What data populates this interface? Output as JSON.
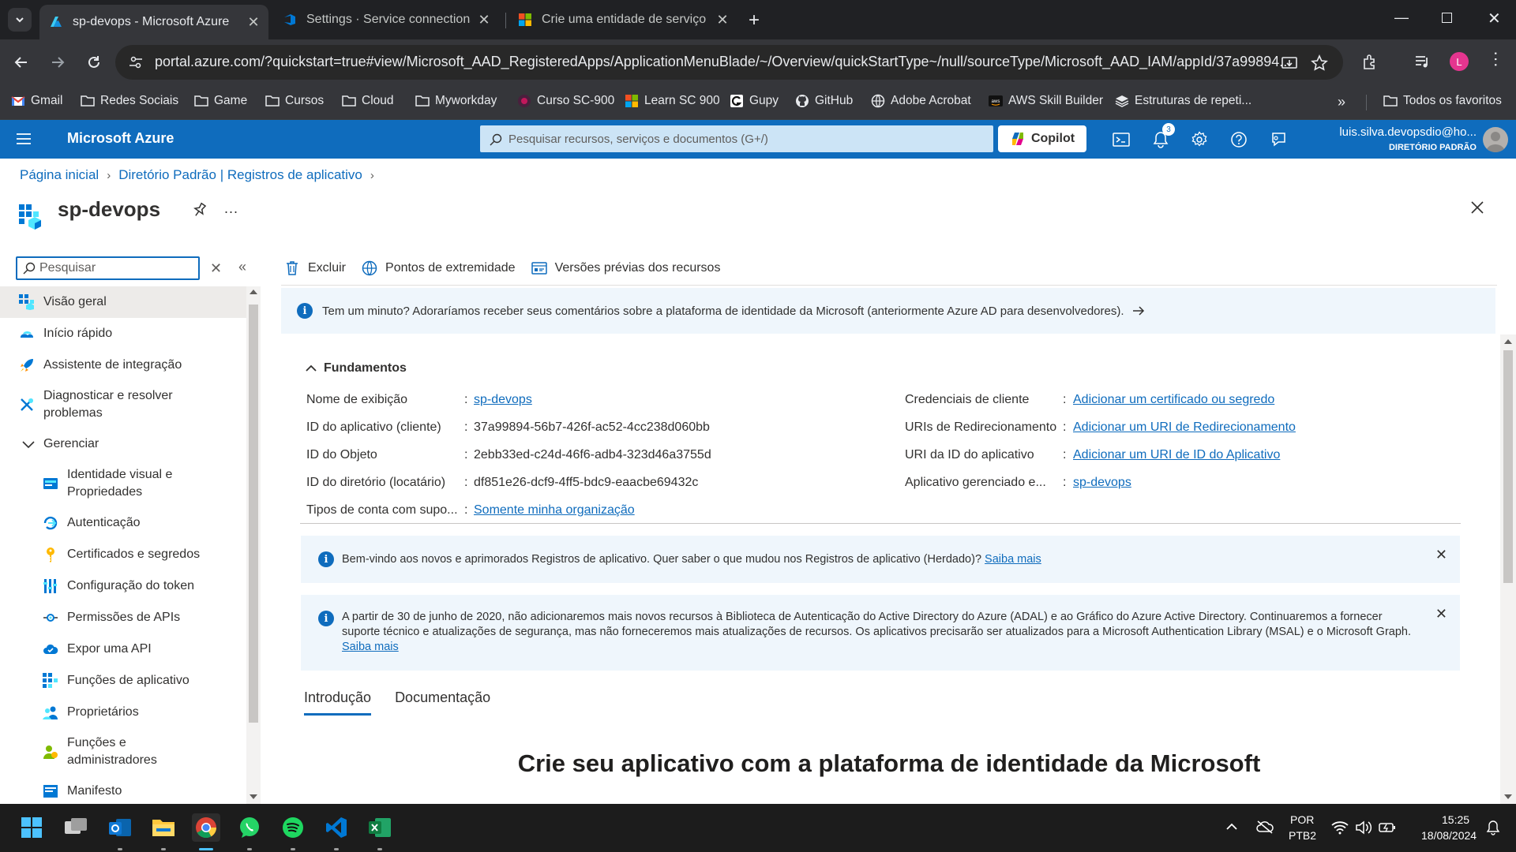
{
  "browser": {
    "tabs": [
      {
        "title": "sp-devops - Microsoft Azure",
        "active": true
      },
      {
        "title": "Settings · Service connections (/",
        "active": false
      },
      {
        "title": "Crie uma entidade de serviço no",
        "active": false
      }
    ],
    "url": "portal.azure.com/?quickstart=true#view/Microsoft_AAD_RegisteredApps/ApplicationMenuBlade/~/Overview/quickStartType~/null/sourceType/Microsoft_AAD_IAM/appId/37a99894...",
    "profile_initial": "L",
    "bookmarks": [
      "Gmail",
      "Redes Sociais",
      "Game",
      "Cursos",
      "Cloud",
      "Myworkday",
      "Curso SC-900",
      "Learn SC 900",
      "Gupy",
      "GitHub",
      "Adobe Acrobat",
      "AWS Skill Builder",
      "Estruturas de repeti..."
    ],
    "all_bookmarks": "Todos os favoritos"
  },
  "azure_header": {
    "brand": "Microsoft Azure",
    "search_placeholder": "Pesquisar recursos, serviços e documentos (G+/)",
    "copilot": "Copilot",
    "notification_count": "3",
    "user_name": "luis.silva.devopsdio@ho...",
    "user_directory": "DIRETÓRIO PADRÃO"
  },
  "breadcrumb": [
    "Página inicial",
    "Diretório Padrão | Registros de aplicativo"
  ],
  "blade": {
    "title": "sp-devops",
    "more": "..."
  },
  "menu": {
    "search_placeholder": "Pesquisar",
    "items": [
      {
        "label": "Visão geral",
        "icon": "overview-icon",
        "selected": true
      },
      {
        "label": "Início rápido",
        "icon": "quickstart-icon"
      },
      {
        "label": "Assistente de integração",
        "icon": "rocket-icon"
      },
      {
        "label": "Diagnosticar e resolver problemas",
        "icon": "wrench-icon"
      },
      {
        "label": "Gerenciar",
        "icon": "chevron-down-icon"
      },
      {
        "label": "Identidade visual e Propriedades",
        "icon": "branding-icon"
      },
      {
        "label": "Autenticação",
        "icon": "authentication-icon"
      },
      {
        "label": "Certificados e segredos",
        "icon": "key-icon"
      },
      {
        "label": "Configuração do token",
        "icon": "token-icon"
      },
      {
        "label": "Permissões de APIs",
        "icon": "api-permissions-icon"
      },
      {
        "label": "Expor uma API",
        "icon": "cloud-icon"
      },
      {
        "label": "Funções de aplicativo",
        "icon": "app-roles-icon"
      },
      {
        "label": "Proprietários",
        "icon": "owners-icon"
      },
      {
        "label": "Funções e administradores",
        "icon": "roles-admins-icon"
      },
      {
        "label": "Manifesto",
        "icon": "manifest-icon"
      }
    ]
  },
  "commands": [
    "Excluir",
    "Pontos de extremidade",
    "Versões prévias dos recursos"
  ],
  "feedback_banner": "Tem um minuto? Adoraríamos receber seus comentários sobre a plataforma de identidade da Microsoft (anteriormente Azure AD para desenvolvedores).",
  "essentials": {
    "title": "Fundamentos",
    "left": [
      {
        "label": "Nome de exibição",
        "value": "sp-devops",
        "link": true
      },
      {
        "label": "ID do aplicativo (cliente)",
        "value": "37a99894-56b7-426f-ac52-4cc238d060bb",
        "link": false
      },
      {
        "label": "ID do Objeto",
        "value": "2ebb33ed-c24d-46f6-adb4-323d46a3755d",
        "link": false
      },
      {
        "label": "ID do diretório (locatário)",
        "value": "df851e26-dcf9-4ff5-bdc9-eaacbe69432c",
        "link": false
      },
      {
        "label": "Tipos de conta com supo...",
        "value": "Somente minha organização",
        "link": true
      }
    ],
    "right": [
      {
        "label": "Credenciais de cliente",
        "value": "Adicionar um certificado ou segredo",
        "link": true
      },
      {
        "label": "URIs de Redirecionamento",
        "value": "Adicionar um URI de Redirecionamento",
        "link": true
      },
      {
        "label": "URI da ID do aplicativo",
        "value": "Adicionar um URI de ID do Aplicativo",
        "link": true
      },
      {
        "label": "Aplicativo gerenciado e...",
        "value": "sp-devops",
        "link": true
      }
    ]
  },
  "notices": [
    {
      "text": "Bem-vindo aos novos e aprimorados Registros de aplicativo. Quer saber o que mudou nos Registros de aplicativo (Herdado)?",
      "link": "Saiba mais"
    },
    {
      "text": "A partir de 30 de junho de 2020, não adicionaremos mais novos recursos à Biblioteca de Autenticação do Active Directory do Azure (ADAL) e ao Gráfico do Azure Active Directory. Continuaremos a fornecer suporte técnico e atualizações de segurança, mas não forneceremos mais atualizações de recursos. Os aplicativos precisarão ser atualizados para a Microsoft Authentication Library (MSAL) e o Microsoft Graph.",
      "link": "Saiba mais"
    }
  ],
  "content_tabs": [
    {
      "label": "Introdução",
      "active": true
    },
    {
      "label": "Documentação",
      "active": false
    }
  ],
  "hero_title": "Crie seu aplicativo com a plataforma de identidade da Microsoft",
  "taskbar": {
    "language": "POR",
    "layout": "PTB2",
    "time": "15:25",
    "date": "18/08/2024"
  },
  "colors": {
    "azure_blue": "#0f6cbd",
    "chrome_dark": "#202124",
    "info_bg": "#eff6fc"
  }
}
